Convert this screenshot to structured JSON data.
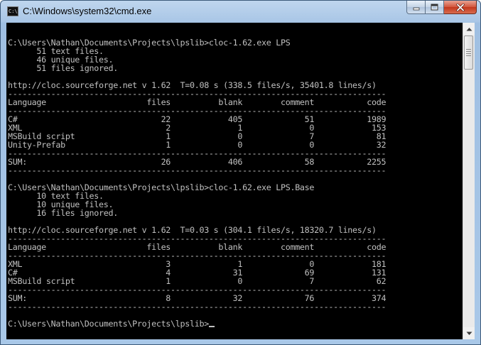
{
  "window": {
    "title": "C:\\Windows\\system32\\cmd.exe",
    "icon": "console-app-icon",
    "icon_glyph": "C:\\",
    "minimize_icon": "minimize-icon",
    "maximize_icon": "maximize-icon",
    "close_icon": "close-icon"
  },
  "console": {
    "background": "#000000",
    "foreground": "#c0c0c0",
    "lines": [
      "",
      "C:\\Users\\Nathan\\Documents\\Projects\\lpslib>cloc-1.62.exe LPS",
      "      51 text files.",
      "      46 unique files.",
      "      51 files ignored.",
      "",
      "http://cloc.sourceforge.net v 1.62  T=0.08 s (338.5 files/s, 35401.8 lines/s)",
      "-------------------------------------------------------------------------------",
      "Language                     files          blank        comment           code",
      "-------------------------------------------------------------------------------",
      "C#                              22            405             51           1989",
      "XML                              2              1              0            153",
      "MSBuild script                   1              0              7             81",
      "Unity-Prefab                     1              0              0             32",
      "-------------------------------------------------------------------------------",
      "SUM:                            26            406             58           2255",
      "-------------------------------------------------------------------------------",
      "",
      "C:\\Users\\Nathan\\Documents\\Projects\\lpslib>cloc-1.62.exe LPS.Base",
      "      10 text files.",
      "      10 unique files.",
      "      16 files ignored.",
      "",
      "http://cloc.sourceforge.net v 1.62  T=0.03 s (304.1 files/s, 18320.7 lines/s)",
      "-------------------------------------------------------------------------------",
      "Language                     files          blank        comment           code",
      "-------------------------------------------------------------------------------",
      "XML                              3              1              0            181",
      "C#                               4             31             69            131",
      "MSBuild script                   1              0              7             62",
      "-------------------------------------------------------------------------------",
      "SUM:                             8             32             76            374",
      "-------------------------------------------------------------------------------",
      "",
      "C:\\Users\\Nathan\\Documents\\Projects\\lpslib>"
    ]
  },
  "scrollbar": {
    "up_icon": "scroll-up-arrow-icon",
    "down_icon": "scroll-down-arrow-icon",
    "position_fraction": 0.0
  }
}
